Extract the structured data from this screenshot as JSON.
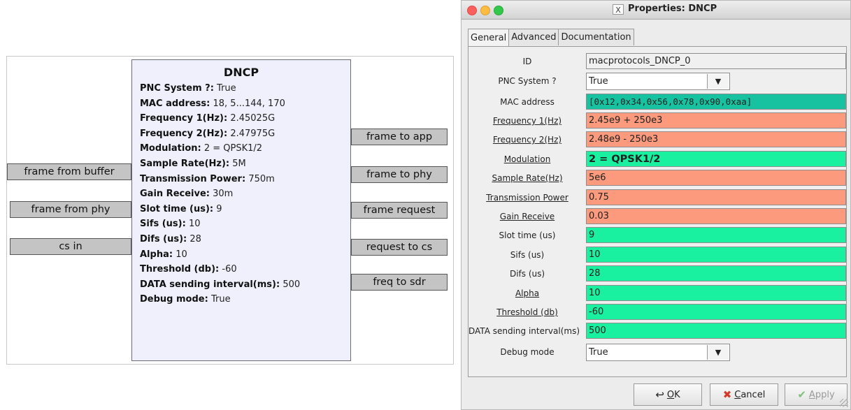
{
  "flowgraph": {
    "block": {
      "title": "DNCP",
      "params": [
        {
          "key": "PNC System ?:",
          "value": "True"
        },
        {
          "key": "MAC address:",
          "value": "18, 5...144, 170"
        },
        {
          "key": "Frequency 1(Hz):",
          "value": "2.45025G"
        },
        {
          "key": "Frequency 2(Hz):",
          "value": "2.47975G"
        },
        {
          "key": "Modulation:",
          "value": "2 = QPSK1/2"
        },
        {
          "key": "Sample Rate(Hz):",
          "value": "5M"
        },
        {
          "key": "Transmission Power:",
          "value": "750m"
        },
        {
          "key": "Gain Receive:",
          "value": "30m"
        },
        {
          "key": "Slot time (us):",
          "value": "9"
        },
        {
          "key": "Sifs (us):",
          "value": "10"
        },
        {
          "key": "Difs (us):",
          "value": "28"
        },
        {
          "key": "Alpha:",
          "value": "10"
        },
        {
          "key": "Threshold (db):",
          "value": "-60"
        },
        {
          "key": "DATA sending interval(ms):",
          "value": "500"
        },
        {
          "key": "Debug mode:",
          "value": "True"
        }
      ]
    },
    "inputs": [
      "frame from buffer",
      "frame from phy",
      "cs in"
    ],
    "outputs": [
      "frame to app",
      "frame to phy",
      "frame request",
      "request to cs",
      "freq to sdr"
    ]
  },
  "dialog": {
    "title": "Properties: DNCP",
    "window_icon": "X",
    "tabs": [
      "General",
      "Advanced",
      "Documentation"
    ],
    "active_tab": "General",
    "fields": {
      "id": {
        "label": "ID",
        "value": "macprotocols_DNCP_0"
      },
      "pnc": {
        "label": "PNC System ?",
        "value": "True"
      },
      "mac": {
        "label": "MAC address",
        "value": "[0x12,0x34,0x56,0x78,0x90,0xaa]"
      },
      "freq1": {
        "label": "Frequency 1(Hz)",
        "value": "2.45e9 + 250e3"
      },
      "freq2": {
        "label": "Frequency 2(Hz)",
        "value": "2.48e9 - 250e3"
      },
      "modulation": {
        "label": "Modulation",
        "value": "2 = QPSK1/2"
      },
      "samprate": {
        "label": "Sample Rate(Hz)",
        "value": "5e6"
      },
      "txpower": {
        "label": "Transmission Power",
        "value": "0.75"
      },
      "gain": {
        "label": "Gain Receive",
        "value": "0.03"
      },
      "slot": {
        "label": "Slot time (us)",
        "value": "9"
      },
      "sifs": {
        "label": "Sifs (us)",
        "value": "10"
      },
      "difs": {
        "label": "Difs (us)",
        "value": "28"
      },
      "alpha": {
        "label": "Alpha",
        "value": "10"
      },
      "threshold": {
        "label": "Threshold (db)",
        "value": "-60"
      },
      "interval": {
        "label": "DATA sending interval(ms)",
        "value": "500"
      },
      "debug": {
        "label": "Debug mode",
        "value": "True"
      }
    },
    "buttons": {
      "ok": {
        "mnemonic": "O",
        "rest": "K"
      },
      "cancel": {
        "mnemonic": "C",
        "rest": "ancel"
      },
      "apply": {
        "mnemonic": "A",
        "rest": "pply"
      }
    },
    "colors": {
      "mac_field": "#16c29f",
      "float_field": "#fb9a7c",
      "int_field": "#19f0a0",
      "block_fill": "#f0f0fc",
      "port_fill": "#c4c4c4"
    }
  }
}
